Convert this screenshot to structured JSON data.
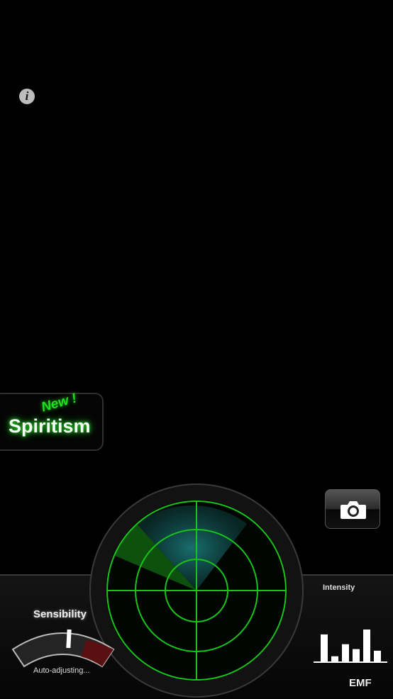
{
  "info": {
    "icon": "info-icon",
    "glyph": "i"
  },
  "spiritism": {
    "badge": "New !",
    "label": "Spiritism",
    "accent": "#1fe01f"
  },
  "camera": {
    "icon": "camera-icon"
  },
  "radar": {
    "color": "#19c419"
  },
  "sensibility": {
    "label": "Sensibility",
    "status": "Auto-adjusting..."
  },
  "intensity": {
    "label": "Intensity",
    "levels": [
      0.85,
      0.18,
      0.55,
      0.4,
      1.0,
      0.35
    ]
  },
  "emf": {
    "label": "EMF"
  }
}
